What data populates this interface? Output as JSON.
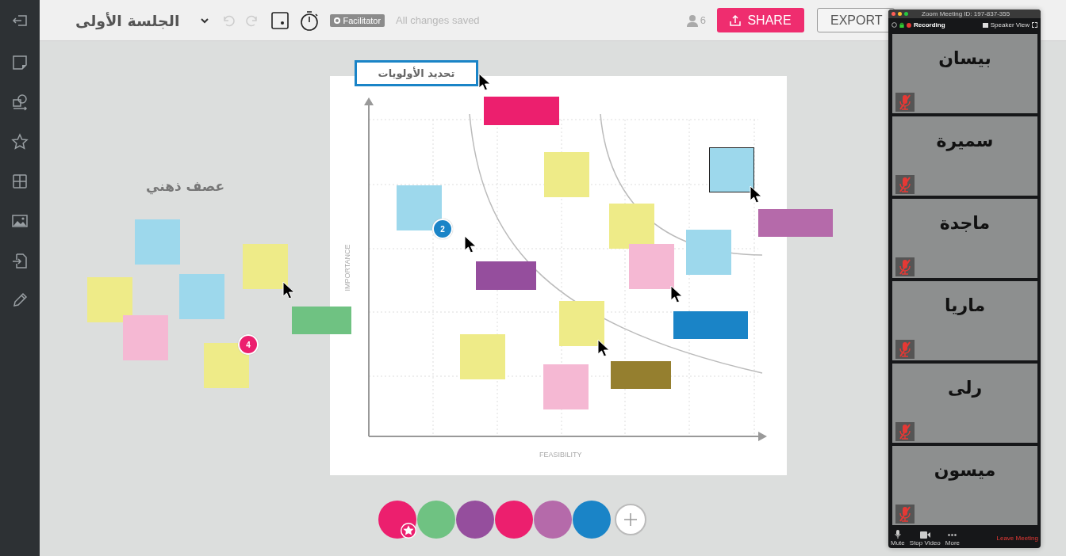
{
  "toolbar": {
    "title": "الجلسة الأولى",
    "role_badge": "Facilitator",
    "save_status": "All changes saved",
    "participants": "6",
    "share": "SHARE",
    "export": "EXPORT"
  },
  "canvas": {
    "frame_label": "عصف ذهني",
    "matrix": {
      "title": "تحديد الأولويات",
      "y_label": "IMPORTANCE",
      "x_label": "FEASIBILITY"
    },
    "notes": [
      {
        "color": "#9dd8ec",
        "selected": false
      },
      {
        "color": "#eeeb88",
        "selected": false
      },
      {
        "color": "#eeeb88",
        "selected": false
      },
      {
        "color": "#9dd8ec",
        "selected": false
      },
      {
        "color": "#f5b8d3",
        "selected": false
      },
      {
        "color": "#eeeb88",
        "selected": false
      },
      {
        "color": "#6fc282",
        "selected": false
      },
      {
        "color": "#ec1f6e",
        "selected": false
      },
      {
        "color": "#eeeb88",
        "selected": false
      },
      {
        "color": "#9dd8ec",
        "selected": false
      },
      {
        "color": "#eeeb88",
        "selected": false
      },
      {
        "color": "#f5b8d3",
        "selected": false
      },
      {
        "color": "#9dd8ec",
        "selected": false
      },
      {
        "color": "#9dd8ec",
        "selected": true
      },
      {
        "color": "#b56aaa",
        "selected": false
      },
      {
        "color": "#954e9d",
        "selected": false
      },
      {
        "color": "#eeeb88",
        "selected": false
      },
      {
        "color": "#1a84c7",
        "selected": false
      },
      {
        "color": "#eeeb88",
        "selected": false
      },
      {
        "color": "#f5b8d3",
        "selected": false
      },
      {
        "color": "#957f2f",
        "selected": false
      }
    ],
    "badges": [
      {
        "text": "2",
        "color": "#1a84c7"
      },
      {
        "text": "4",
        "color": "#ec1f6e"
      }
    ],
    "palette": [
      {
        "color": "#ec1f6e",
        "selected": true
      },
      {
        "color": "#6fc282",
        "selected": false
      },
      {
        "color": "#954e9d",
        "selected": false
      },
      {
        "color": "#ec1f6e",
        "selected": false
      },
      {
        "color": "#b56aaa",
        "selected": false
      },
      {
        "color": "#1a84c7",
        "selected": false
      }
    ]
  },
  "zoom_window": {
    "title": "Zoom Meeting ID: 197-837-355",
    "recording": "Recording",
    "view": "Speaker View",
    "tiles": [
      {
        "name": "بيسان",
        "muted": true
      },
      {
        "name": "سميرة",
        "muted": true
      },
      {
        "name": "ماجدة",
        "muted": true
      },
      {
        "name": "ماريا",
        "muted": true
      },
      {
        "name": "رلى",
        "muted": true
      },
      {
        "name": "ميسون",
        "muted": true
      }
    ],
    "mute": "Mute",
    "stop_video": "Stop Video",
    "more": "More",
    "leave": "Leave Meeting"
  }
}
